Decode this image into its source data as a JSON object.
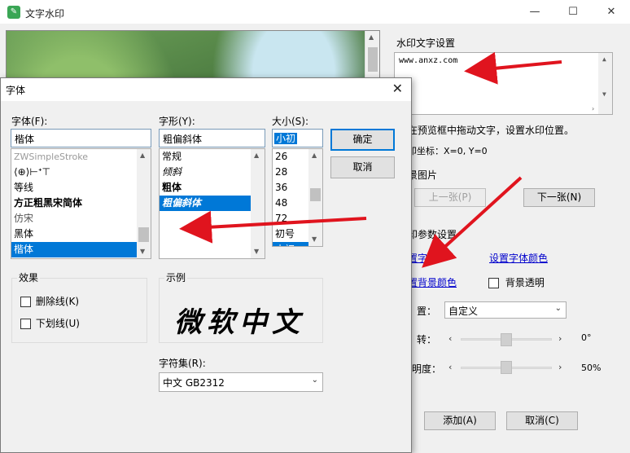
{
  "window": {
    "title": "文字水印",
    "minimize": "—",
    "maximize": "☐",
    "close": "✕"
  },
  "right_panel": {
    "watermark_text_label": "水印文字设置",
    "watermark_text_value": "www.anxz.com",
    "hint": "在预览框中拖动文字，设置水印位置。",
    "coords": "印坐标：X=0, Y=0",
    "image_section": "景图片",
    "prev_button": "上一张(P)",
    "next_button": "下一张(N)",
    "params_section": "印参数设置",
    "set_font_link": "置字体",
    "set_font_color_link": "设置字体颜色",
    "set_bg_color_link": "置背景颜色",
    "bg_transparent_label": "背景透明",
    "position_label": "置：",
    "position_value": "自定义",
    "rotate_label": "转：",
    "rotate_value": "0°",
    "opacity_label": "明度：",
    "opacity_value": "50%",
    "add_button": "添加(A)",
    "cancel_button": "取消(C)"
  },
  "font_dialog": {
    "title": "字体",
    "font_label": "字体(F):",
    "font_value": "楷体",
    "font_list": [
      "ZWSimpleStroke",
      "⟨⊕⟩⊢ᐩ⊤",
      "等线",
      "方正粗黑宋简体",
      "仿宋",
      "黑体",
      "楷体"
    ],
    "font_selected_index": 6,
    "style_label": "字形(Y):",
    "style_value": "粗偏斜体",
    "style_list": [
      "常规",
      "倾斜",
      "粗体",
      "粗偏斜体"
    ],
    "style_selected_index": 3,
    "size_label": "大小(S):",
    "size_value": "小初",
    "size_list": [
      "26",
      "28",
      "36",
      "48",
      "72",
      "初号",
      "小初"
    ],
    "size_selected_index": 6,
    "ok_button": "确定",
    "cancel_button": "取消",
    "effects_label": "效果",
    "strikeout_label": "删除线(K)",
    "underline_label": "下划线(U)",
    "sample_label": "示例",
    "sample_text": "微软中文",
    "charset_label": "字符集(R):",
    "charset_value": "中文 GB2312"
  },
  "colors": {
    "accent": "#0078d7",
    "annotation_arrow": "#e0141e",
    "link": "#0000cc"
  }
}
